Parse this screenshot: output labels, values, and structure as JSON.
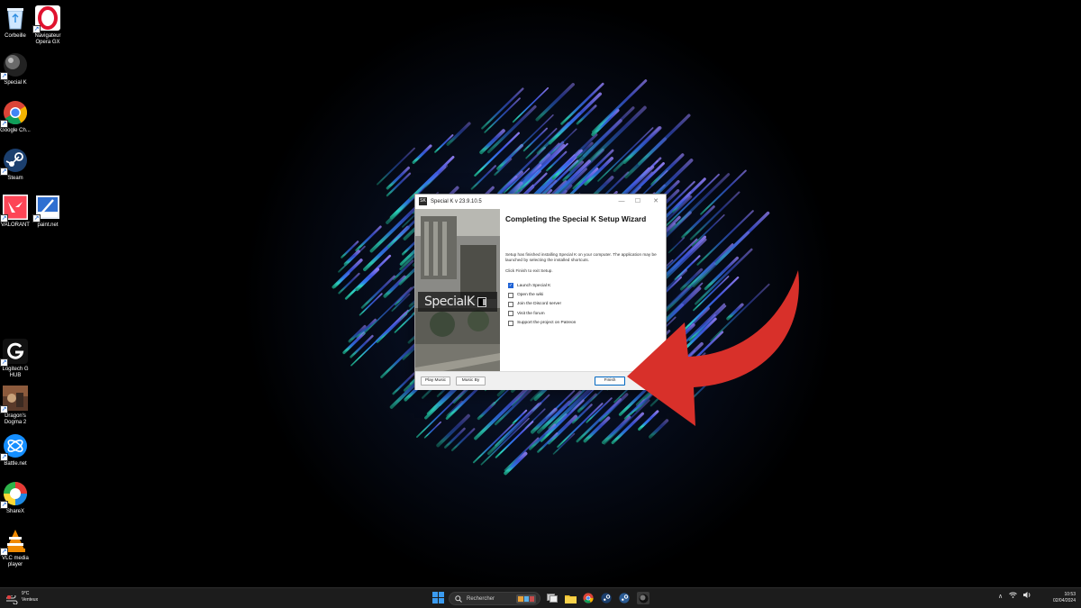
{
  "desktop": {
    "icons": [
      {
        "label": "Corbeille",
        "icon": "recycle-bin-icon"
      },
      {
        "label": "Navigateur\nOpera GX",
        "icon": "opera-gx-icon"
      },
      {
        "label": "Special K",
        "icon": "special-k-icon"
      },
      {
        "label": "Google Ch...",
        "icon": "chrome-icon"
      },
      {
        "label": "Steam",
        "icon": "steam-icon"
      },
      {
        "label": "VALORANT",
        "icon": "valorant-icon"
      },
      {
        "label": "paint.net",
        "icon": "paint-net-icon"
      },
      {
        "label": "Logitech G\nHUB",
        "icon": "logitech-g-hub-icon"
      },
      {
        "label": "Dragon's\nDogma 2",
        "icon": "dragons-dogma-2-icon"
      },
      {
        "label": "Battle.net",
        "icon": "battle-net-icon"
      },
      {
        "label": "ShareX",
        "icon": "sharex-icon"
      },
      {
        "label": "VLC media\nplayer",
        "icon": "vlc-icon"
      }
    ]
  },
  "installer": {
    "title": "Special K v 23.9.10.5",
    "brand_text": "SpecialK",
    "heading": "Completing the Special K Setup Wizard",
    "description": "Setup has finished installing Special K on your computer. The application may be launched by selecting the installed shortcuts.",
    "hint": "Click Finish to exit Setup.",
    "options": [
      {
        "label": "Launch Special K",
        "checked": true
      },
      {
        "label": "Open the wiki",
        "checked": false
      },
      {
        "label": "Join the Discord server",
        "checked": false
      },
      {
        "label": "Visit the forum",
        "checked": false
      },
      {
        "label": "Support the project on Patreon",
        "checked": false
      }
    ],
    "buttons": {
      "play_music": "Play Music",
      "music_by": "Music By",
      "finish": "Finish"
    }
  },
  "taskbar": {
    "weather_temp": "9°C",
    "weather_condition": "Venteux",
    "search_label": "Rechercher",
    "time": "10:53",
    "date": "02/04/2024"
  },
  "colors": {
    "annotation_arrow": "#d8302a",
    "checkbox_accent": "#1f63d6"
  }
}
